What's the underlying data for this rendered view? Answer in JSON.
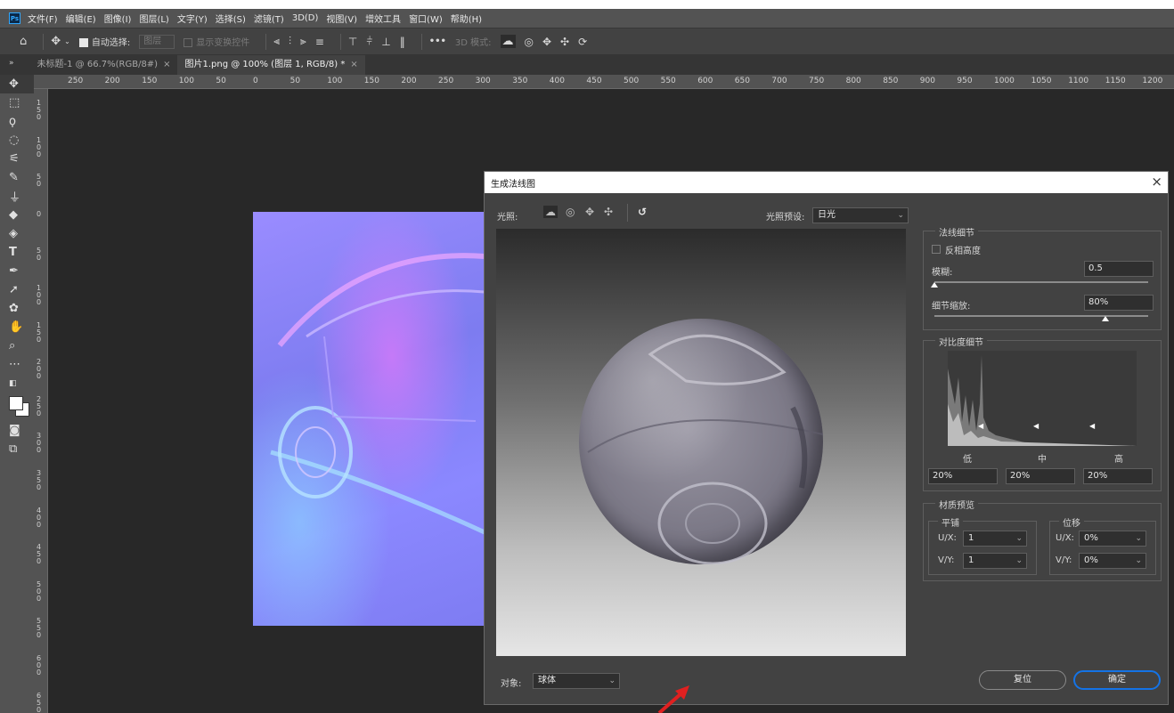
{
  "app": {
    "logo": "Ps"
  },
  "menubar": {
    "items": [
      "文件(F)",
      "编辑(E)",
      "图像(I)",
      "图层(L)",
      "文字(Y)",
      "选择(S)",
      "滤镜(T)",
      "3D(D)",
      "视图(V)",
      "增效工具",
      "窗口(W)",
      "帮助(H)"
    ]
  },
  "options": {
    "auto_select_label": "自动选择:",
    "auto_select_target": "图层",
    "show_transform_label": "显示变换控件",
    "more_label": "•••",
    "mode_label": "3D 模式:"
  },
  "tabs": [
    {
      "label": "未标题-1 @ 66.7%(RGB/8#)",
      "close": "×",
      "active": false
    },
    {
      "label": "图片1.png @ 100% (图层 1, RGB/8) *",
      "close": "×",
      "active": true
    }
  ],
  "ruler_top": [
    "250",
    "200",
    "150",
    "100",
    "50",
    "0",
    "50",
    "100",
    "150",
    "200",
    "250",
    "300",
    "350",
    "400",
    "450",
    "500",
    "550",
    "600",
    "650",
    "700",
    "750",
    "800",
    "850",
    "900",
    "950",
    "1000",
    "1050",
    "1100",
    "1150",
    "1200"
  ],
  "ruler_left": [
    "1\n5\n0",
    "1\n0\n0",
    "5\n0",
    "0",
    "5\n0",
    "1\n0\n0",
    "1\n5\n0",
    "2\n0\n0",
    "2\n5\n0",
    "3\n0\n0",
    "3\n5\n0",
    "4\n0\n0",
    "4\n5\n0",
    "5\n0\n0",
    "5\n5\n0",
    "6\n0\n0",
    "6\n5\n0"
  ],
  "dialog": {
    "title": "生成法线图",
    "close": "×",
    "lighting_label": "光照:",
    "preset_label": "光照预设:",
    "preset_value": "日光",
    "object_label": "对象:",
    "object_value": "球体",
    "normal_details": {
      "title": "法线细节",
      "invert_label": "反相高度",
      "invert_checked": false,
      "blur_label": "模糊:",
      "blur_value": "0.5",
      "blur_level": 0.0,
      "detail_scale_label": "细节缩放:",
      "detail_scale_value": "80%",
      "detail_scale_level": 0.8
    },
    "contrast_details": {
      "title": "对比度细节",
      "low_label": "低",
      "mid_label": "中",
      "high_label": "高",
      "low_value": "20%",
      "mid_value": "20%",
      "high_value": "20%"
    },
    "material_preview": {
      "title": "材质预览",
      "tile_title": "平铺",
      "offset_title": "位移",
      "ux_label": "U/X:",
      "vy_label": "V/Y:",
      "tile_ux": "1",
      "tile_vy": "1",
      "offset_ux": "0%",
      "offset_vy": "0%"
    },
    "reset_label": "复位",
    "ok_label": "确定"
  },
  "colors": {
    "accent": "#1473e6",
    "annotation_arrow": "#e02020"
  }
}
